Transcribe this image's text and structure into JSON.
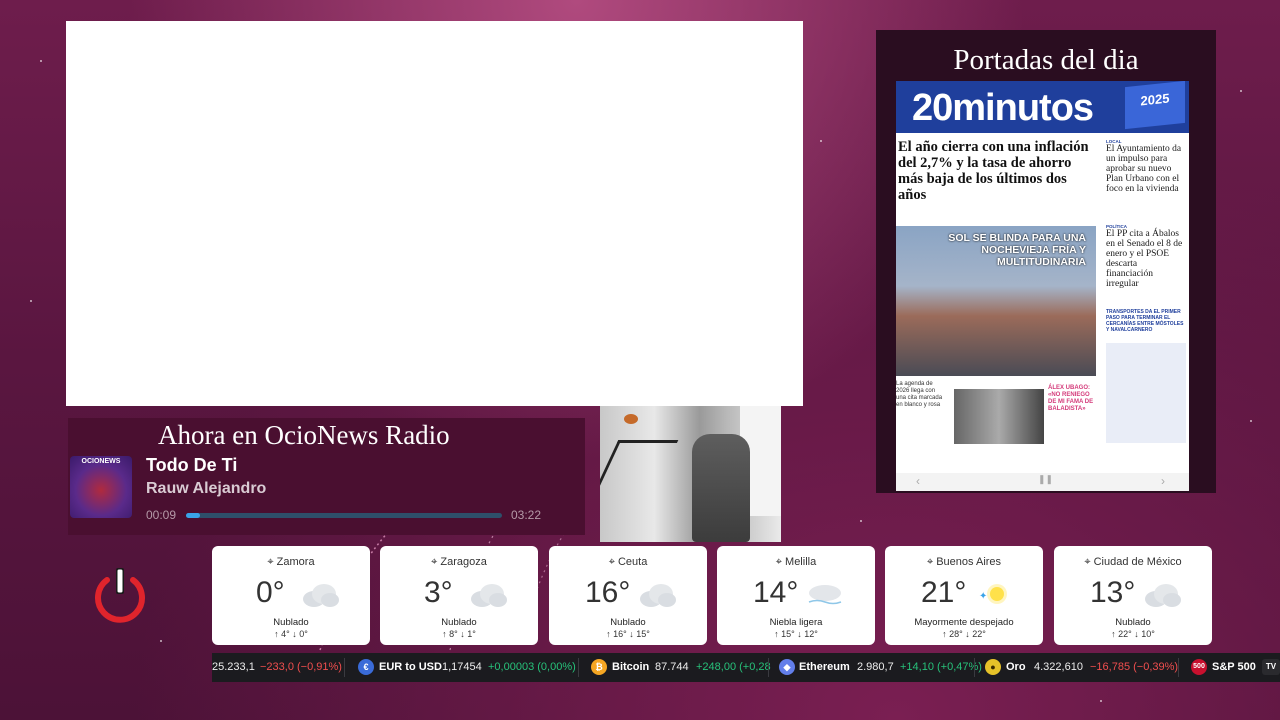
{
  "portadas": {
    "title": "Portadas del dia",
    "paper": {
      "logo": "20minutos",
      "badge": "2025",
      "headline": "El año cierra con una inflación del 2,7% y la tasa de ahorro más baja de los últimos dos años",
      "photo_caption": "SOL SE BLINDA PARA UNA NOCHEVIEJA FRÍA Y MULTITUDINARIA",
      "side1_tag": "LOCAL",
      "side1_head": "El Ayuntamiento da un impulso para aprobar su nuevo Plan Urbano con el foco en la vivienda",
      "side2_tag": "POLÍTICA",
      "side2_head": "El PP cita a Ábalos en el Senado el 8 de enero y el PSOE descarta financiación irregular",
      "side_link": "TRANSPORTES DA EL PRIMER PASO PARA TERMINAR EL CERCANÍAS ENTRE MÓSTOLES Y NAVALCARNERO",
      "bottom_left": "La agenda de 2026 llega con una cita marcada en blanco y rosa",
      "bottom_right": "ÁLEX UBAGO: «NO RENIEGO DE MI FAMA DE BALADISTA»"
    }
  },
  "radio": {
    "title": "Ahora en OcioNews Radio",
    "cover_text": "OCIONEWS",
    "song": "Todo De Ti",
    "artist": "Rauw Alejandro",
    "elapsed": "00:09",
    "duration": "03:22",
    "progress": 0.045
  },
  "weather": [
    {
      "city": "Zamora",
      "temp": "0°",
      "condition": "Nublado",
      "high": "4°",
      "low": "0°",
      "icon": "cloud-icon"
    },
    {
      "city": "Zaragoza",
      "temp": "3°",
      "condition": "Nublado",
      "high": "8°",
      "low": "1°",
      "icon": "cloud-icon"
    },
    {
      "city": "Ceuta",
      "temp": "16°",
      "condition": "Nublado",
      "high": "16°",
      "low": "15°",
      "icon": "cloud-icon"
    },
    {
      "city": "Melilla",
      "temp": "14°",
      "condition": "Niebla ligera",
      "high": "15°",
      "low": "12°",
      "icon": "fog-icon"
    },
    {
      "city": "Buenos Aires",
      "temp": "21°",
      "condition": "Mayormente despejado",
      "high": "28°",
      "low": "22°",
      "icon": "sun-icon"
    },
    {
      "city": "Ciudad de México",
      "temp": "13°",
      "condition": "Nublado",
      "high": "22°",
      "low": "10°",
      "icon": "cloud-icon"
    }
  ],
  "ticker": {
    "items": [
      {
        "name": "",
        "value": "25.233,1",
        "change": "−233,0 (−0,91%)",
        "dir": "down"
      },
      {
        "name": "EUR to USD",
        "value": "1,17454",
        "change": "+0,00003 (0,00%)",
        "dir": "up"
      },
      {
        "name": "Bitcoin",
        "value": "87.744",
        "change": "+248,00 (+0,28",
        "dir": "up"
      },
      {
        "name": "Ethereum",
        "value": "2.980,7",
        "change": "+14,10 (+0,47%)",
        "dir": "up"
      },
      {
        "name": "Oro",
        "value": "4.322,610",
        "change": "−16,785 (−0,39%)",
        "dir": "down"
      },
      {
        "name": "S&P 500",
        "value": "",
        "change": "",
        "dir": "up"
      }
    ],
    "badge_500": "500",
    "tv_logo": "TV"
  },
  "colors": {
    "accent_blue": "#3aa3e8",
    "down": "#f04e4e",
    "up": "#27c27a",
    "power": "#e0242c"
  }
}
